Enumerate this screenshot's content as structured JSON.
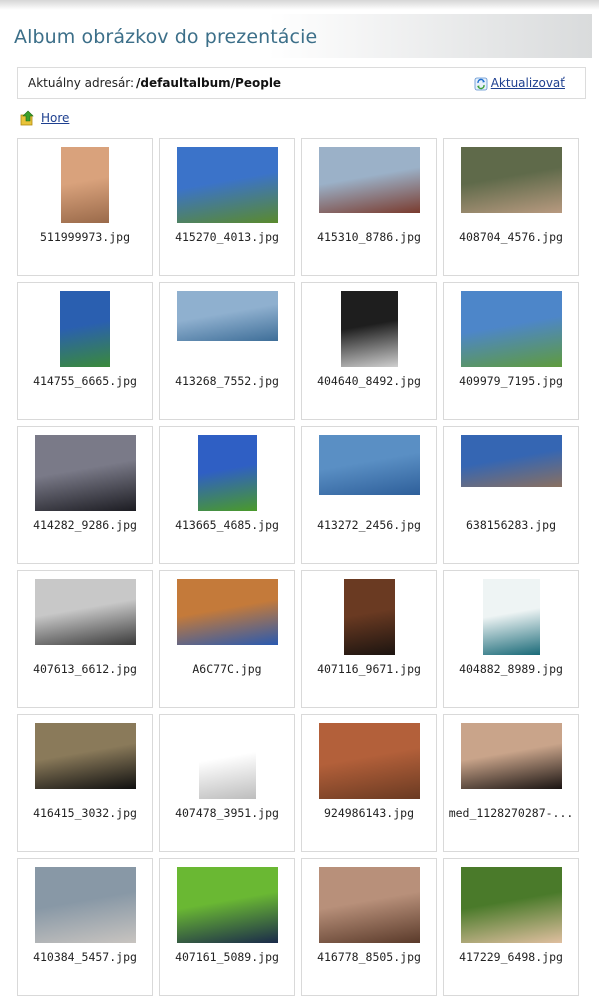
{
  "page": {
    "title": "Album obrázkov do prezentácie"
  },
  "path_bar": {
    "label": "Aktuálny adresár:",
    "path": "/defaultalbum/People",
    "refresh_label": "Aktualizovať",
    "refresh_icon": "refresh-icon"
  },
  "up_link": {
    "label": "Hore",
    "icon": "folder-up-icon"
  },
  "images": [
    {
      "name": "511999973.jpg",
      "colors": [
        "#d9a27c",
        "#9a6a4a"
      ]
    },
    {
      "name": "415270_4013.jpg",
      "colors": [
        "#3b73c9",
        "#5a8a2d"
      ]
    },
    {
      "name": "415310_8786.jpg",
      "colors": [
        "#9bb1c8",
        "#7a3b2e"
      ]
    },
    {
      "name": "408704_4576.jpg",
      "colors": [
        "#5f6a4a",
        "#b89a80"
      ]
    },
    {
      "name": "414755_6665.jpg",
      "colors": [
        "#2a5fb0",
        "#3a8a3a"
      ]
    },
    {
      "name": "413268_7552.jpg",
      "colors": [
        "#8fb0cf",
        "#3e6e98"
      ]
    },
    {
      "name": "404640_8492.jpg",
      "colors": [
        "#1e1e1e",
        "#cfcfcf"
      ]
    },
    {
      "name": "409979_7195.jpg",
      "colors": [
        "#4d86c9",
        "#5f9b3d"
      ]
    },
    {
      "name": "414282_9286.jpg",
      "colors": [
        "#7a7a88",
        "#1c1c22"
      ]
    },
    {
      "name": "413665_4685.jpg",
      "colors": [
        "#2f5fc4",
        "#4a9a2a"
      ]
    },
    {
      "name": "413272_2456.jpg",
      "colors": [
        "#5a8fc4",
        "#2e5f9a"
      ]
    },
    {
      "name": "638156283.jpg",
      "colors": [
        "#3566b3",
        "#8a7060"
      ]
    },
    {
      "name": "407613_6612.jpg",
      "colors": [
        "#c8c8c8",
        "#3a3a3a"
      ]
    },
    {
      "name": "A6C77C.jpg",
      "colors": [
        "#c47a3a",
        "#2a5ab0"
      ]
    },
    {
      "name": "407116_9671.jpg",
      "colors": [
        "#6a3a22",
        "#1c1410"
      ]
    },
    {
      "name": "404882_8989.jpg",
      "colors": [
        "#eef4f4",
        "#1a6a78"
      ]
    },
    {
      "name": "416415_3032.jpg",
      "colors": [
        "#8a7a5a",
        "#101010"
      ]
    },
    {
      "name": "407478_3951.jpg",
      "colors": [
        "#ffffff",
        "#bdbdbd"
      ]
    },
    {
      "name": "924986143.jpg",
      "colors": [
        "#b3603a",
        "#6a3a22"
      ]
    },
    {
      "name": "med_1128270287-...",
      "colors": [
        "#c9a48a",
        "#1a1412"
      ]
    },
    {
      "name": "410384_5457.jpg",
      "colors": [
        "#8898a6",
        "#c8c4c0"
      ]
    },
    {
      "name": "407161_5089.jpg",
      "colors": [
        "#6ab833",
        "#1a2a4a"
      ]
    },
    {
      "name": "416778_8505.jpg",
      "colors": [
        "#b8907a",
        "#5a3a2a"
      ]
    },
    {
      "name": "417229_6498.jpg",
      "colors": [
        "#4a7a2a",
        "#e0bfa0"
      ]
    }
  ]
}
